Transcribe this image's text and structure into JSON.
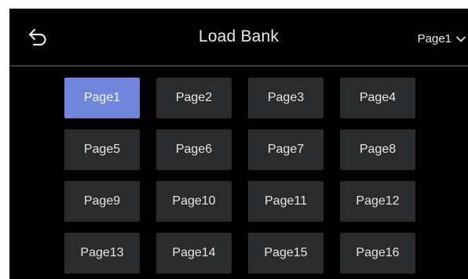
{
  "header": {
    "title": "Load Bank",
    "page_selector": "Page1",
    "back_icon": "back-arrow-icon",
    "dropdown_icon": "chevron-down-icon"
  },
  "colors": {
    "background": "#000000",
    "tile": "#2a2b2d",
    "selected_tile": "#6f86dc",
    "text": "#e6e6e6"
  },
  "grid": {
    "selected_index": 0,
    "tiles": [
      {
        "label": "Page1"
      },
      {
        "label": "Page2"
      },
      {
        "label": "Page3"
      },
      {
        "label": "Page4"
      },
      {
        "label": "Page5"
      },
      {
        "label": "Page6"
      },
      {
        "label": "Page7"
      },
      {
        "label": "Page8"
      },
      {
        "label": "Page9"
      },
      {
        "label": "Page10"
      },
      {
        "label": "Page11"
      },
      {
        "label": "Page12"
      },
      {
        "label": "Page13"
      },
      {
        "label": "Page14"
      },
      {
        "label": "Page15"
      },
      {
        "label": "Page16"
      }
    ]
  }
}
